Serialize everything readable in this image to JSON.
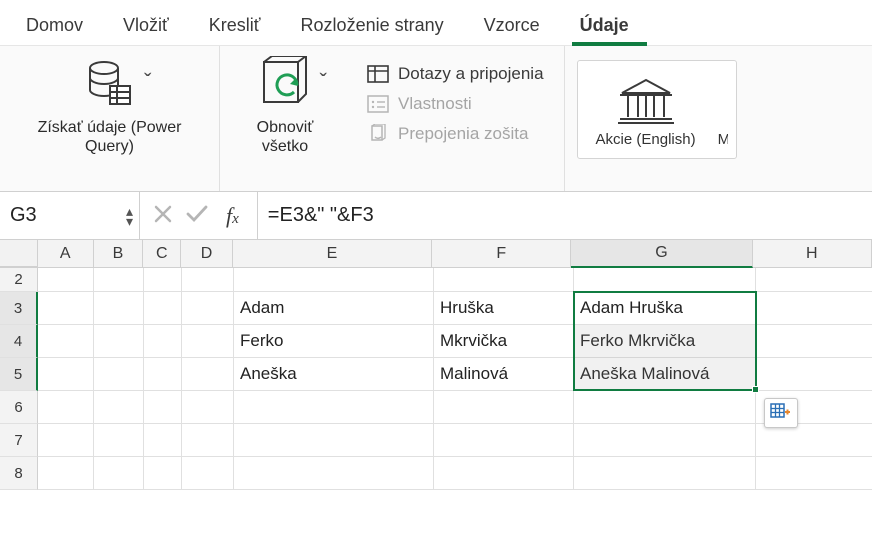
{
  "tabs": {
    "home": "Domov",
    "insert": "Vložiť",
    "draw": "Kresliť",
    "page_layout": "Rozloženie strany",
    "formulas": "Vzorce",
    "data": "Údaje"
  },
  "ribbon": {
    "get_data_label": "Získať údaje (Power Query)",
    "refresh_label": "Obnoviť všetko",
    "queries_label": "Dotazy a pripojenia",
    "properties_label": "Vlastnosti",
    "workbook_links_label": "Prepojenia zošita",
    "stocks_label": "Akcie (English)",
    "maps_partial": "Me"
  },
  "formula_bar": {
    "name_box": "G3",
    "formula": "=E3&\" \"&F3"
  },
  "columns": [
    "A",
    "B",
    "C",
    "D",
    "E",
    "F",
    "G",
    "H"
  ],
  "rows_visible": [
    "2",
    "3",
    "4",
    "5",
    "6",
    "7",
    "8"
  ],
  "data": {
    "E3": "Adam",
    "F3": "Hruška",
    "G3": "Adam Hruška",
    "E4": "Ferko",
    "F4": "Mkrvička",
    "G4": "Ferko Mkrvička",
    "E5": "Aneška",
    "F5": "Malinová",
    "G5": "Aneška Malinová"
  },
  "selection": {
    "start": "G3",
    "end": "G5"
  }
}
